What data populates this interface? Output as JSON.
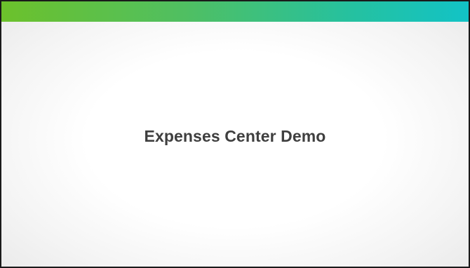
{
  "slide": {
    "title": "Expenses Center Demo"
  },
  "colors": {
    "header_gradient_start": "#6cc12b",
    "header_gradient_end": "#12c3c6",
    "title_text": "#3f3f3f"
  }
}
